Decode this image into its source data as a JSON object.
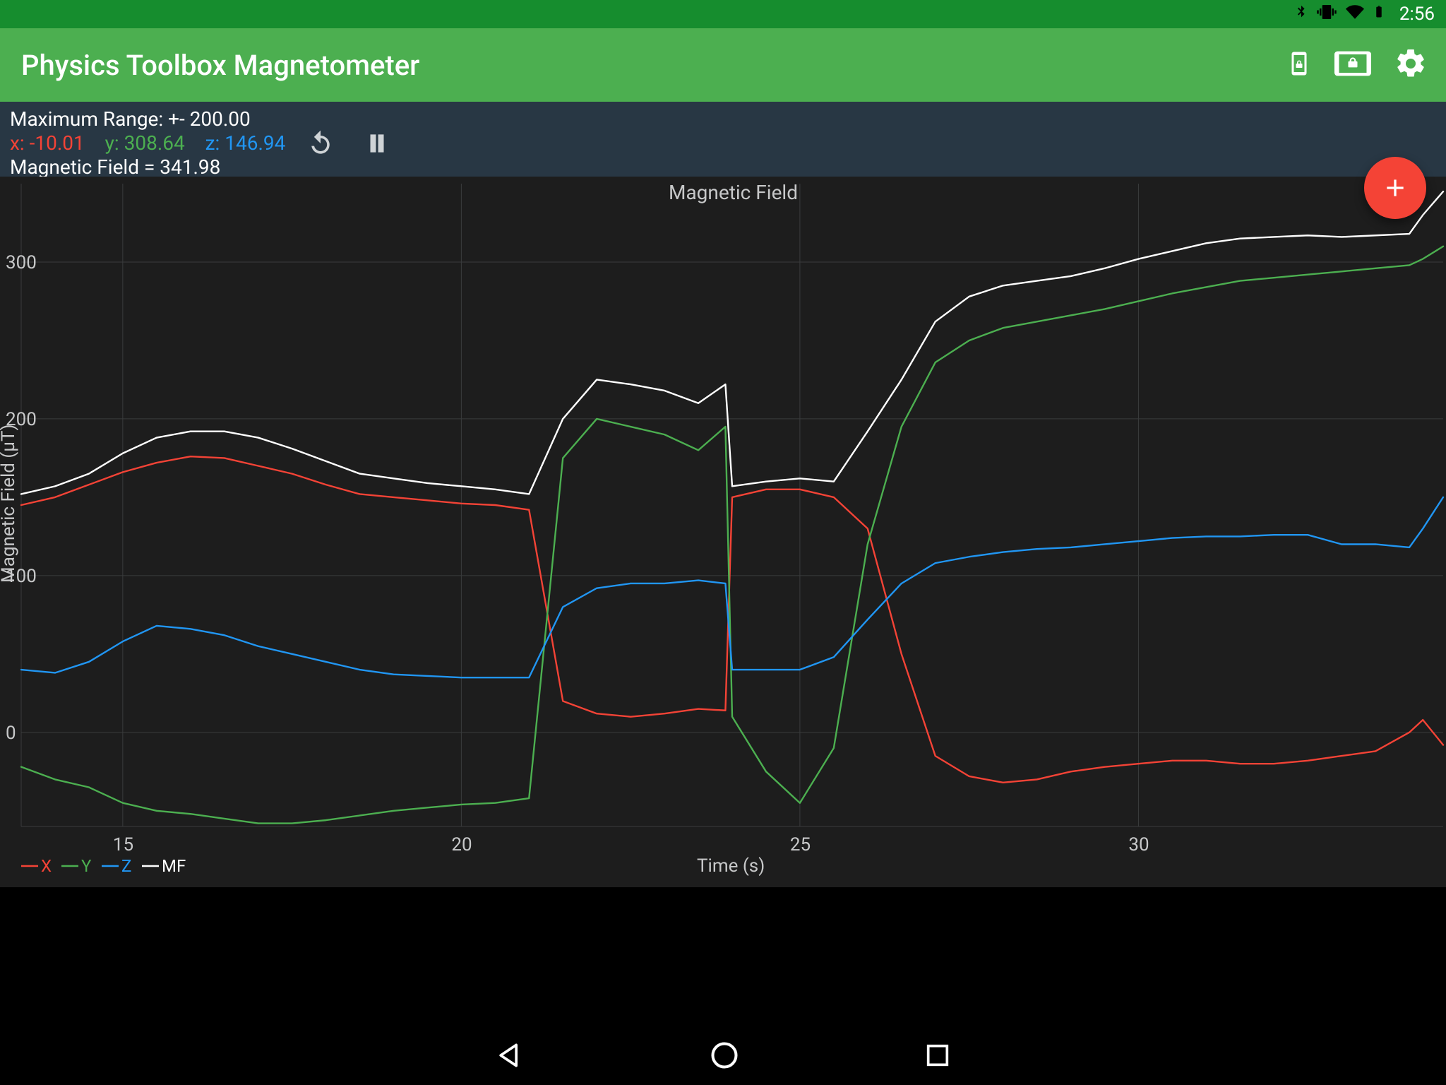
{
  "status_bar": {
    "time": "2:56"
  },
  "app": {
    "title": "Physics Toolbox Magnetometer"
  },
  "info": {
    "max_range": "Maximum Range: +- 200.00",
    "x_label": "x: -10.01",
    "y_label": "y: 308.64",
    "z_label": "z: 146.94",
    "mf_label": "Magnetic Field = 341.98"
  },
  "fab": {
    "glyph": "+"
  },
  "chart_data": {
    "type": "line",
    "title": "Magnetic Field",
    "xlabel": "Time (s)",
    "ylabel": "Magnetic Field (µT)",
    "xlim": [
      13.5,
      34.5
    ],
    "ylim": [
      -60,
      350
    ],
    "x_ticks": [
      15,
      20,
      25,
      30
    ],
    "y_ticks": [
      0,
      100,
      200,
      300
    ],
    "legend": [
      {
        "name": "X",
        "color": "#f44336"
      },
      {
        "name": "Y",
        "color": "#4caf50"
      },
      {
        "name": "Z",
        "color": "#2196f3"
      },
      {
        "name": "MF",
        "color": "#ffffff"
      }
    ],
    "x": [
      13.5,
      14,
      14.5,
      15,
      15.5,
      16,
      16.5,
      17,
      17.5,
      18,
      18.5,
      19,
      19.5,
      20,
      20.5,
      21,
      21.5,
      22,
      22.5,
      23,
      23.5,
      23.9,
      24,
      24.5,
      25,
      25.5,
      26,
      26.5,
      27,
      27.5,
      28,
      28.5,
      29,
      29.5,
      30,
      30.5,
      31,
      31.5,
      32,
      32.5,
      33,
      33.5,
      34,
      34.2,
      34.5
    ],
    "series": [
      {
        "name": "X",
        "color": "#f44336",
        "values": [
          145,
          150,
          158,
          166,
          172,
          176,
          175,
          170,
          165,
          158,
          152,
          150,
          148,
          146,
          145,
          142,
          20,
          12,
          10,
          12,
          15,
          14,
          150,
          155,
          155,
          150,
          130,
          50,
          -15,
          -28,
          -32,
          -30,
          -25,
          -22,
          -20,
          -18,
          -18,
          -20,
          -20,
          -18,
          -15,
          -12,
          0,
          8,
          -8
        ]
      },
      {
        "name": "Y",
        "color": "#4caf50",
        "values": [
          -22,
          -30,
          -35,
          -45,
          -50,
          -52,
          -55,
          -58,
          -58,
          -56,
          -53,
          -50,
          -48,
          -46,
          -45,
          -42,
          175,
          200,
          195,
          190,
          180,
          195,
          10,
          -25,
          -45,
          -10,
          120,
          195,
          236,
          250,
          258,
          262,
          266,
          270,
          275,
          280,
          284,
          288,
          290,
          292,
          294,
          296,
          298,
          302,
          310
        ]
      },
      {
        "name": "Z",
        "color": "#2196f3",
        "values": [
          40,
          38,
          45,
          58,
          68,
          66,
          62,
          55,
          50,
          45,
          40,
          37,
          36,
          35,
          35,
          35,
          80,
          92,
          95,
          95,
          97,
          95,
          40,
          40,
          40,
          48,
          72,
          95,
          108,
          112,
          115,
          117,
          118,
          120,
          122,
          124,
          125,
          125,
          126,
          126,
          120,
          120,
          118,
          130,
          150
        ]
      },
      {
        "name": "MF",
        "color": "#ffffff",
        "values": [
          152,
          157,
          165,
          178,
          188,
          192,
          192,
          188,
          181,
          173,
          165,
          162,
          159,
          157,
          155,
          152,
          200,
          225,
          222,
          218,
          210,
          222,
          157,
          160,
          162,
          160,
          192,
          225,
          262,
          278,
          285,
          288,
          291,
          296,
          302,
          307,
          312,
          315,
          316,
          317,
          316,
          317,
          318,
          330,
          345
        ]
      }
    ]
  }
}
